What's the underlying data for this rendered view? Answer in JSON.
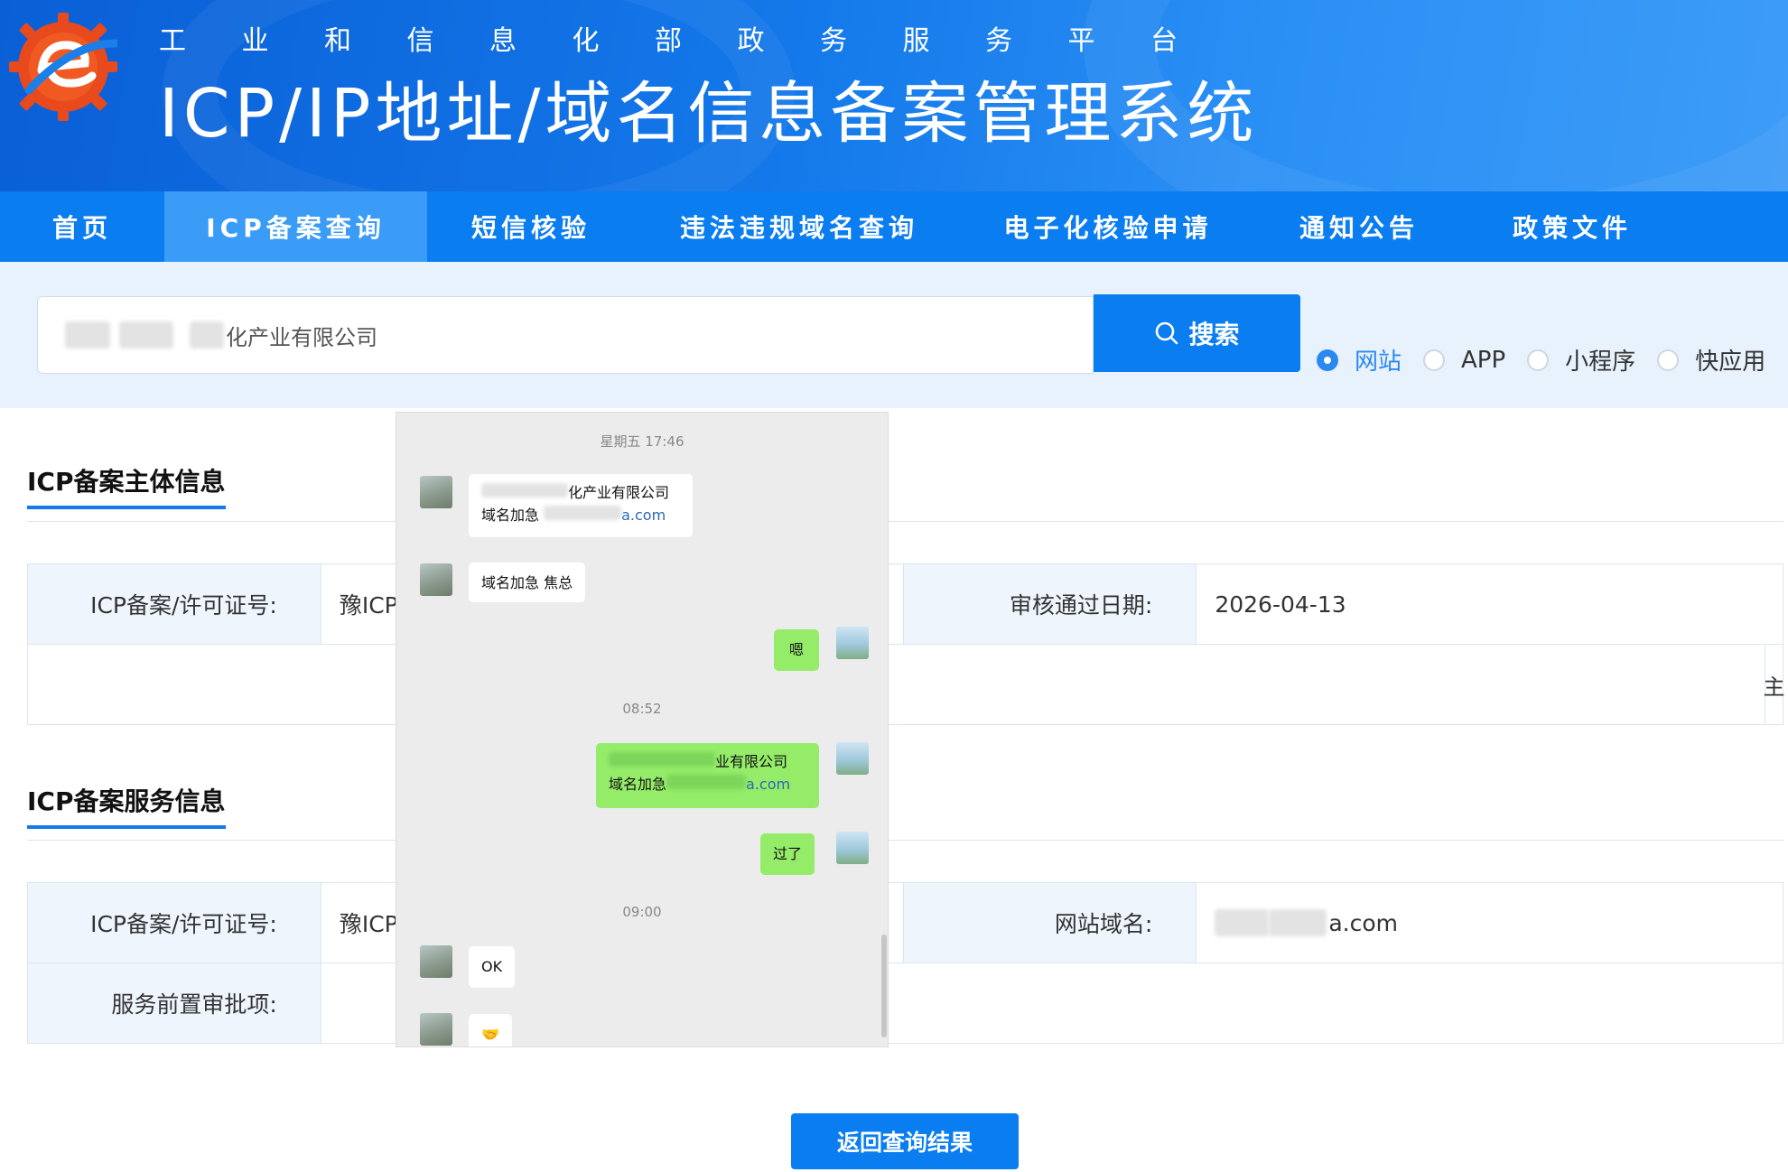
{
  "colors": {
    "primary": "#0a7df0",
    "nav_active": "#3a9cf6",
    "strip": "#e8f2fd",
    "chat_green": "#95ec69"
  },
  "header": {
    "subtitle_chars": [
      "工",
      "业",
      "和",
      "信",
      "息",
      "化",
      "部",
      "政",
      "务",
      "服",
      "务",
      "平",
      "台"
    ],
    "title": "ICP/IP地址/域名信息备案管理系统"
  },
  "nav": [
    {
      "label": "首页"
    },
    {
      "label": "ICP备案查询"
    },
    {
      "label": "短信核验"
    },
    {
      "label": "违法违规域名查询"
    },
    {
      "label": "电子化核验申请"
    },
    {
      "label": "通知公告"
    },
    {
      "label": "政策文件"
    }
  ],
  "search": {
    "value_visible": "化产业有限公司",
    "button_label": "搜索",
    "search_icon": "search-icon",
    "radios": [
      {
        "label": "网站",
        "checked": true
      },
      {
        "label": "APP",
        "checked": false
      },
      {
        "label": "小程序",
        "checked": false
      },
      {
        "label": "快应用",
        "checked": false
      }
    ]
  },
  "section_subject": {
    "title": "ICP备案主体信息",
    "row1": {
      "label1": "ICP备案/许可证号:",
      "value1": "豫ICP",
      "label2": "审核通过日期:",
      "value2": "2026-04-13"
    },
    "row2_edge": "主"
  },
  "section_service": {
    "title": "ICP备案服务信息",
    "row1": {
      "label1": "ICP备案/许可证号:",
      "value1": "豫ICP",
      "label2": "网站域名:",
      "value2": "a.com"
    },
    "row2": {
      "label1": "服务前置审批项:"
    }
  },
  "back_button": "返回查询结果",
  "chat": {
    "times": [
      "星期五 17:46",
      "08:52",
      "09:00"
    ],
    "messages": [
      {
        "side": "left",
        "line1": "化产业有限公司",
        "line2_prefix": "域名加急",
        "line2_link": "a.com"
      },
      {
        "side": "left",
        "text": "域名加急  焦总"
      },
      {
        "side": "right",
        "text": "嗯"
      },
      {
        "side": "right",
        "line1": "业有限公司",
        "line2_prefix": "域名加急",
        "line2_link": "a.com"
      },
      {
        "side": "right",
        "text": "过了"
      },
      {
        "side": "left",
        "text": "OK"
      },
      {
        "side": "left",
        "text": "🤝"
      }
    ]
  }
}
